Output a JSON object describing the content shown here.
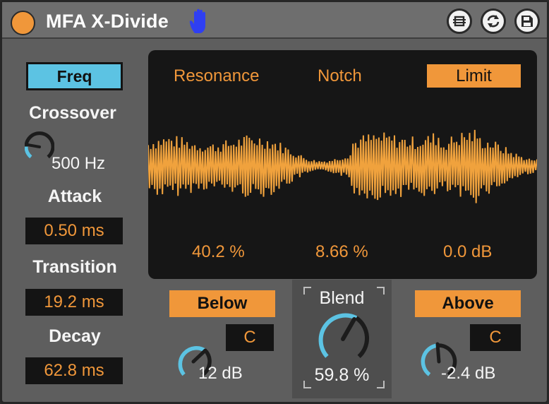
{
  "device": {
    "title": "MFA X-Divide",
    "power_color": "#f0973a",
    "icons": [
      "hand-icon",
      "map-icon",
      "sync-icon",
      "save-icon"
    ]
  },
  "left": {
    "mode_button": "Freq",
    "crossover_label": "Crossover",
    "crossover_value": "500 Hz",
    "attack_label": "Attack",
    "attack_value": "0.50 ms",
    "transition_label": "Transition",
    "transition_value": "19.2 ms",
    "decay_label": "Decay",
    "decay_value": "62.8 ms"
  },
  "display": {
    "resonance_label": "Resonance",
    "notch_label": "Notch",
    "limit_label": "Limit",
    "resonance_value": "40.2 %",
    "notch_value": "8.66 %",
    "limit_value": "0.0 dB"
  },
  "bottom": {
    "below_label": "Below",
    "below_mode": "C",
    "below_value": "12 dB",
    "blend_label": "Blend",
    "blend_value": "59.8 %",
    "above_label": "Above",
    "above_mode": "C",
    "above_value": "-2.4 dB"
  },
  "colors": {
    "accent": "#f0973a",
    "mode_blue": "#5cc3e3",
    "knob_arc": "#5cc3e3"
  }
}
